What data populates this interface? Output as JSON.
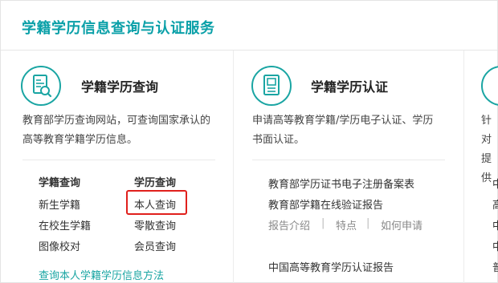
{
  "header": {
    "title": "学籍学历信息查询与认证服务"
  },
  "card1": {
    "title": "学籍学历查询",
    "desc_line1": "教育部学历查询网站，可查询国家承认的",
    "desc_line2": "高等教育学籍学历信息。",
    "col1_head": "学籍查询",
    "col2_head": "学历查询",
    "col1_items": [
      "新生学籍",
      "在校生学籍",
      "图像校对"
    ],
    "col2_items": [
      "本人查询",
      "零散查询",
      "会员查询"
    ],
    "bottom_link": "查询本人学籍学历信息方法"
  },
  "card2": {
    "title": "学籍学历认证",
    "desc_line1": "申请高等教育学籍/学历电子认证、学历",
    "desc_line2": "书面认证。",
    "links": [
      "教育部学历证书电子注册备案表",
      "教育部学籍在线验证报告"
    ],
    "sub_links": [
      "报告介绍",
      "特点",
      "如何申请"
    ],
    "sub_sep": "|",
    "link3": "中国高等教育学历认证报告"
  },
  "card3": {
    "desc_line1": "针对",
    "desc_line2": "提供",
    "items": [
      "中",
      "高",
      "中",
      "中",
      "普"
    ]
  },
  "colors": {
    "accent": "#1aa5a3",
    "title": "#0aa0a8",
    "highlight": "#e0201c"
  }
}
